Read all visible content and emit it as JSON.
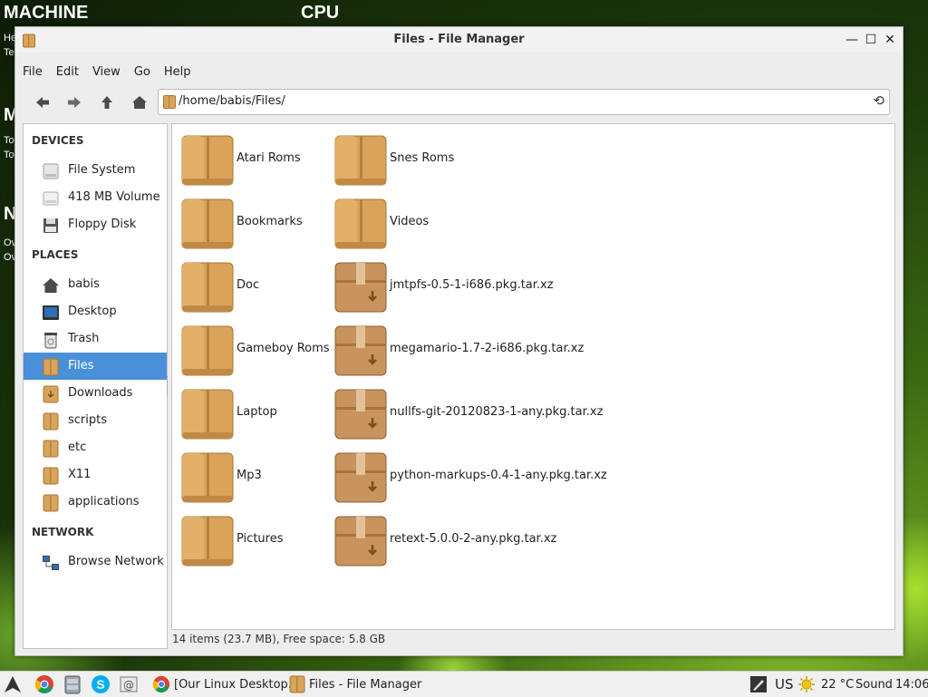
{
  "desktop": {
    "conky": {
      "machine": "MACHINE",
      "cpu": "CPU",
      "frag_he": "He",
      "frag_te": "Te",
      "frag_m": "M",
      "frag_to1": "To",
      "frag_to2": "To",
      "frag_n": "N",
      "frag_ov1": "Ov",
      "frag_ov2": "Ov"
    }
  },
  "window": {
    "title": "Files - File Manager",
    "controls": {
      "minimize": "—",
      "maximize": "☐",
      "close": "✕"
    }
  },
  "menu": [
    "File",
    "Edit",
    "View",
    "Go",
    "Help"
  ],
  "pathbar": {
    "path": "/home/babis/Files/"
  },
  "sidebar": {
    "devices_label": "DEVICES",
    "devices": [
      {
        "label": "File System",
        "icon": "hard-drive-icon"
      },
      {
        "label": "418 MB Volume",
        "icon": "drive-icon"
      },
      {
        "label": "Floppy Disk",
        "icon": "floppy-icon"
      }
    ],
    "places_label": "PLACES",
    "places": [
      {
        "label": "babis",
        "icon": "home-icon"
      },
      {
        "label": "Desktop",
        "icon": "desktop-icon"
      },
      {
        "label": "Trash",
        "icon": "trash-icon"
      },
      {
        "label": "Files",
        "icon": "folder-icon"
      },
      {
        "label": "Downloads",
        "icon": "downloads-folder-icon"
      },
      {
        "label": "scripts",
        "icon": "folder-icon"
      },
      {
        "label": "etc",
        "icon": "folder-icon"
      },
      {
        "label": "X11",
        "icon": "folder-icon"
      },
      {
        "label": "applications",
        "icon": "folder-icon"
      }
    ],
    "network_label": "NETWORK",
    "network": [
      {
        "label": "Browse Network",
        "icon": "network-icon"
      }
    ]
  },
  "files": {
    "col1": [
      "Atari Roms",
      "Bookmarks",
      "Doc",
      "Gameboy Roms",
      "Laptop",
      "Mp3",
      "Pictures"
    ],
    "col2": [
      "Snes Roms",
      "Videos",
      "jmtpfs-0.5-1-i686.pkg.tar.xz",
      "megamario-1.7-2-i686.pkg.tar.xz",
      "nullfs-git-20120823-1-any.pkg.tar.xz",
      "python-markups-0.4-1-any.pkg.tar.xz",
      "retext-5.0.0-2-any.pkg.tar.xz"
    ]
  },
  "status": "14 items (23.7 MB), Free space: 5.8 GB",
  "taskbar": {
    "tasks": [
      {
        "label": "[Our Linux Desktop...",
        "icon": "chrome-icon"
      },
      {
        "label": "Files - File Manager",
        "icon": "folder-icon"
      }
    ],
    "keyboard": "US",
    "temperature": "22 °C",
    "sound": "Sound",
    "clock": "14:06"
  },
  "colors": {
    "selection": "#4a90d9",
    "folder": "#d9a35a"
  }
}
